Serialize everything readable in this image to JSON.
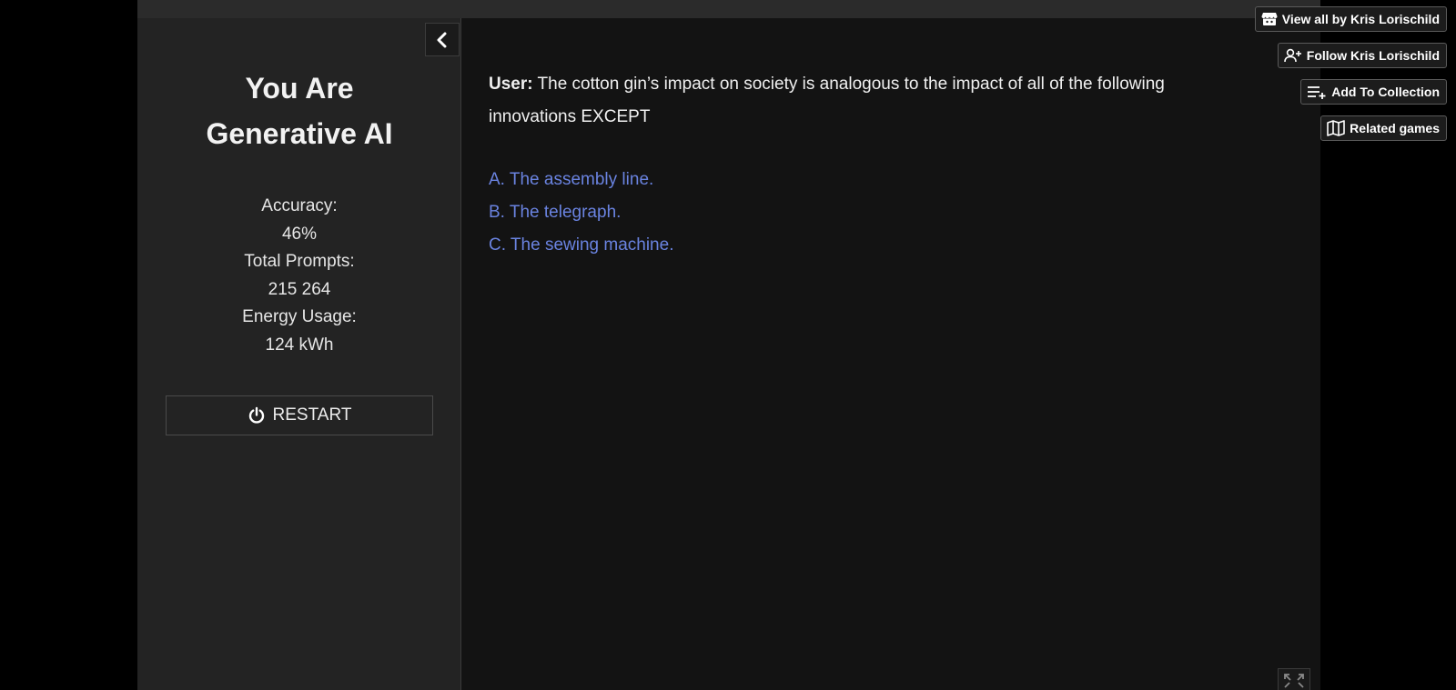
{
  "sidebar": {
    "title_line1": "You Are",
    "title_line2": "Generative AI",
    "stats": {
      "accuracy_label": "Accuracy:",
      "accuracy_value": "46%",
      "prompts_label": "Total Prompts:",
      "prompts_value": "215 264",
      "energy_label": "Energy Usage:",
      "energy_value": "124 kWh"
    },
    "restart_label": "RESTART"
  },
  "question": {
    "speaker": "User:",
    "text": "The cotton gin’s impact on society is analogous to the impact of all of the following innovations EXCEPT",
    "options": [
      "A. The assembly line.",
      "B. The telegraph.",
      "C. The sewing machine."
    ]
  },
  "itch_toolbar": {
    "view_all": "View all by Kris Lorischild",
    "follow": "Follow Kris Lorischild",
    "add_collection": "Add To Collection",
    "related": "Related games"
  },
  "colors": {
    "option_link": "#6a83e0",
    "sidebar_bg": "#232323",
    "main_bg": "#131313"
  }
}
